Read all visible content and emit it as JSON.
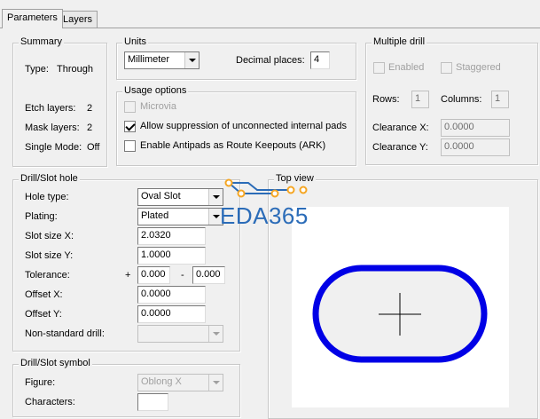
{
  "tabs": [
    {
      "label": "Parameters",
      "active": true
    },
    {
      "label": "Layers",
      "active": false
    }
  ],
  "summary": {
    "title": "Summary",
    "type_label": "Type:",
    "type_value": "Through",
    "etch_label": "Etch layers:",
    "etch_value": "2",
    "mask_label": "Mask layers:",
    "mask_value": "2",
    "single_label": "Single Mode:",
    "single_value": "Off"
  },
  "units": {
    "title": "Units",
    "unit_value": "Millimeter",
    "decimal_label": "Decimal places:",
    "decimal_value": "4"
  },
  "usage": {
    "title": "Usage options",
    "microvia_label": "Microvia",
    "microvia_checked": false,
    "suppress_label": "Allow suppression of unconnected internal pads",
    "suppress_checked": true,
    "antipads_label": "Enable Antipads as Route Keepouts (ARK)",
    "antipads_checked": false
  },
  "multiple_drill": {
    "title": "Multiple drill",
    "enabled_label": "Enabled",
    "staggered_label": "Staggered",
    "rows_label": "Rows:",
    "rows_value": "1",
    "columns_label": "Columns:",
    "columns_value": "1",
    "clearance_x_label": "Clearance X:",
    "clearance_x_value": "0.0000",
    "clearance_y_label": "Clearance Y:",
    "clearance_y_value": "0.0000"
  },
  "drill_slot_hole": {
    "title": "Drill/Slot hole",
    "hole_type_label": "Hole type:",
    "hole_type_value": "Oval Slot",
    "plating_label": "Plating:",
    "plating_value": "Plated",
    "slot_x_label": "Slot size X:",
    "slot_x_value": "2.0320",
    "slot_y_label": "Slot size Y:",
    "slot_y_value": "1.0000",
    "tolerance_label": "Tolerance:",
    "tolerance_plus": "+",
    "tolerance_plus_value": "0.000",
    "tolerance_minus": "-",
    "tolerance_minus_value": "0.000",
    "offset_x_label": "Offset X:",
    "offset_x_value": "0.0000",
    "offset_y_label": "Offset Y:",
    "offset_y_value": "0.0000",
    "nonstandard_label": "Non-standard drill:",
    "nonstandard_value": ""
  },
  "drill_slot_symbol": {
    "title": "Drill/Slot symbol",
    "figure_label": "Figure:",
    "figure_value": "Oblong X",
    "characters_label": "Characters:",
    "characters_value": ""
  },
  "top_view": {
    "title": "Top view"
  },
  "watermark": {
    "text": "EDA365",
    "color": "#2b6cb8",
    "accent": "#f5a623"
  },
  "colors": {
    "pad_outline": "#0000e6",
    "window_bg": "#f0f0f0"
  }
}
